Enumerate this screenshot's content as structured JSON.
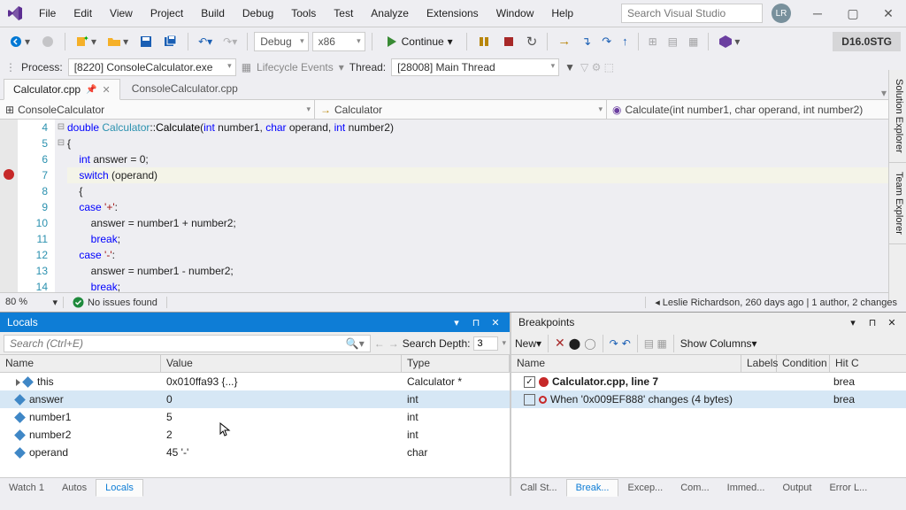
{
  "menus": [
    "File",
    "Edit",
    "View",
    "Project",
    "Build",
    "Debug",
    "Tools",
    "Test",
    "Analyze",
    "Extensions",
    "Window",
    "Help"
  ],
  "search_placeholder": "Search Visual Studio",
  "avatar": "LR",
  "version_badge": "D16.0STG",
  "toolbar": {
    "config": "Debug",
    "platform": "x86",
    "continue": "Continue"
  },
  "process": {
    "label": "Process:",
    "value": "[8220] ConsoleCalculator.exe",
    "lifecycle": "Lifecycle Events",
    "thread_label": "Thread:",
    "thread": "[28008] Main Thread"
  },
  "tabs": {
    "active": "Calculator.cpp",
    "other": "ConsoleCalculator.cpp"
  },
  "nav": {
    "scope": "ConsoleCalculator",
    "class": "Calculator",
    "func": "Calculate(int number1, char operand, int number2)"
  },
  "code": {
    "lines": [
      4,
      5,
      6,
      7,
      8,
      9,
      10,
      11,
      12,
      13,
      14
    ],
    "breakpoint_line": 7
  },
  "status": {
    "zoom": "80 %",
    "issues": "No issues found",
    "lens": "Leslie Richardson, 260 days ago | 1 author, 2 changes"
  },
  "locals": {
    "title": "Locals",
    "search_placeholder": "Search (Ctrl+E)",
    "depth_label": "Search Depth:",
    "depth": "3",
    "cols": [
      "Name",
      "Value",
      "Type"
    ],
    "rows": [
      {
        "name": "this",
        "value": "0x010ffa93 {...}",
        "type": "Calculator *",
        "expand": true
      },
      {
        "name": "answer",
        "value": "0",
        "type": "int",
        "sel": true
      },
      {
        "name": "number1",
        "value": "5",
        "type": "int"
      },
      {
        "name": "number2",
        "value": "2",
        "type": "int"
      },
      {
        "name": "operand",
        "value": "45 '-'",
        "type": "char"
      }
    ]
  },
  "breakpoints": {
    "title": "Breakpoints",
    "new": "New",
    "show": "Show Columns",
    "cols": [
      "Name",
      "Labels",
      "Condition",
      "Hit C"
    ],
    "rows": [
      {
        "checked": true,
        "filled": true,
        "label": "Calculator.cpp, line 7",
        "bold": true,
        "hit": "brea"
      },
      {
        "checked": false,
        "filled": false,
        "label": "When '0x009EF888' changes (4 bytes)",
        "sel": true,
        "hit": "brea"
      }
    ]
  },
  "left_tabs": [
    "Watch 1",
    "Autos",
    "Locals"
  ],
  "right_tabs": [
    "Call St...",
    "Break...",
    "Excep...",
    "Com...",
    "Immed...",
    "Output",
    "Error L..."
  ],
  "side_panels": [
    "Solution Explorer",
    "Team Explorer"
  ]
}
